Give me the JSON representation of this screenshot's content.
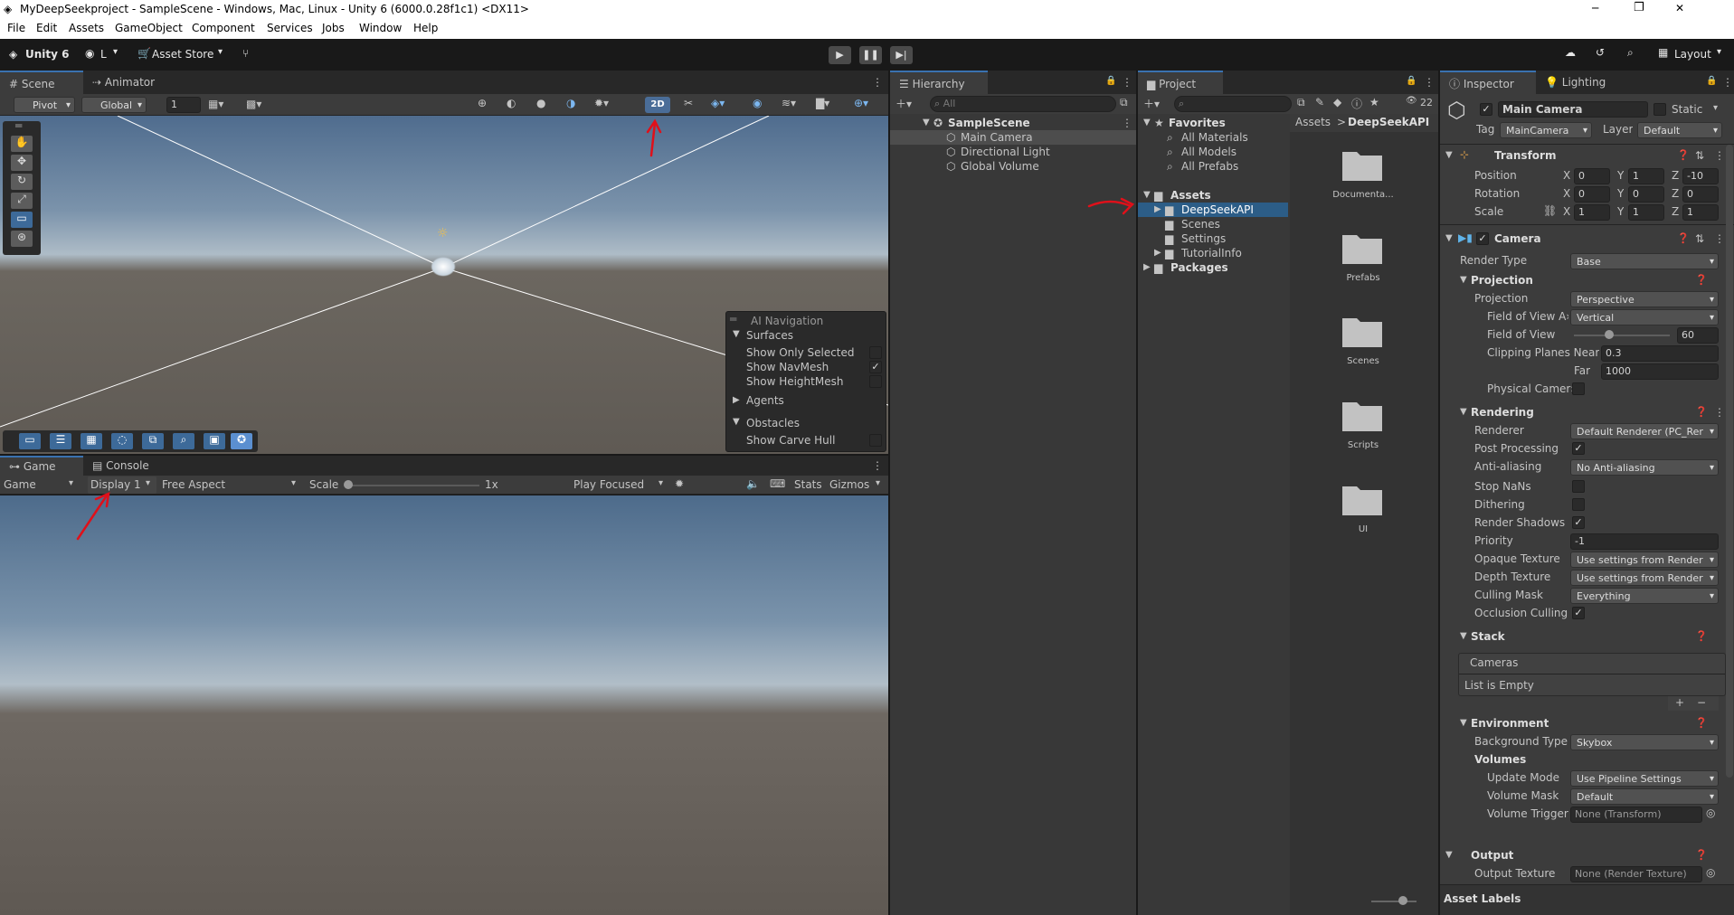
{
  "window": {
    "title": "MyDeepSeekproject - SampleScene - Windows, Mac, Linux - Unity 6 (6000.0.28f1c1) <DX11>",
    "controls": [
      "─",
      "❐",
      "✕"
    ]
  },
  "menu": [
    "File",
    "Edit",
    "Assets",
    "GameObject",
    "Component",
    "Services",
    "Jobs",
    "Window",
    "Help"
  ],
  "toolbar": {
    "unity": "Unity 6",
    "account": "L",
    "asset_store": "Asset Store",
    "layout": "Layout"
  },
  "scene": {
    "tabs": [
      "Scene",
      "Animator"
    ],
    "pivot": "Pivot",
    "global": "Global",
    "grid_value": "1",
    "mode_2d": "2D"
  },
  "ai_nav": {
    "title": "AI Navigation",
    "surfaces": "Surfaces",
    "items": [
      {
        "label": "Show Only Selected",
        "checked": false
      },
      {
        "label": "Show NavMesh",
        "checked": true
      },
      {
        "label": "Show HeightMesh",
        "checked": false
      }
    ],
    "agents": "Agents",
    "obstacles": "Obstacles",
    "carve": "Show Carve Hull"
  },
  "game": {
    "tabs": [
      "Game",
      "Console"
    ],
    "mode": "Game",
    "display": "Display 1",
    "aspect": "Free Aspect",
    "scale_label": "Scale",
    "scale_value": "1x",
    "play_focused": "Play Focused",
    "stats": "Stats",
    "gizmos": "Gizmos"
  },
  "hierarchy": {
    "tab": "Hierarchy",
    "search": "All",
    "scene": "SampleScene",
    "items": [
      "Main Camera",
      "Directional Light",
      "Global Volume"
    ]
  },
  "project": {
    "tab": "Project",
    "count": "22",
    "favorites": "Favorites",
    "fav_items": [
      "All Materials",
      "All Models",
      "All Prefabs"
    ],
    "assets": "Assets",
    "asset_items": [
      "DeepSeekAPI",
      "Scenes",
      "Settings",
      "TutorialInfo"
    ],
    "packages": "Packages",
    "breadcrumb": [
      "Assets",
      ">",
      "DeepSeekAPI"
    ],
    "folders": [
      "Documenta...",
      "Prefabs",
      "Scenes",
      "Scripts",
      "UI"
    ]
  },
  "inspector": {
    "tabs": [
      "Inspector",
      "Lighting"
    ],
    "object_name": "Main Camera",
    "static": "Static",
    "tag_label": "Tag",
    "tag": "MainCamera",
    "layer_label": "Layer",
    "layer": "Default",
    "transform": {
      "title": "Transform",
      "rows": [
        {
          "label": "Position",
          "x": "0",
          "y": "1",
          "z": "-10"
        },
        {
          "label": "Rotation",
          "x": "0",
          "y": "0",
          "z": "0"
        },
        {
          "label": "Scale",
          "x": "1",
          "y": "1",
          "z": "1"
        }
      ]
    },
    "camera": {
      "title": "Camera",
      "render_type_label": "Render Type",
      "render_type": "Base",
      "projection_header": "Projection",
      "projection_label": "Projection",
      "projection": "Perspective",
      "fov_axis_label": "Field of View A›",
      "fov_axis": "Vertical",
      "fov_label": "Field of View",
      "fov": "60",
      "fov_fraction": 0.46,
      "clip_label": "Clipping Planes Near",
      "near": "0.3",
      "far_label": "Far",
      "far": "1000",
      "physical_label": "Physical Camer›",
      "rendering_header": "Rendering",
      "renderer_label": "Renderer",
      "renderer": "Default Renderer (PC_Rer",
      "post_label": "Post Processing",
      "aa_label": "Anti-aliasing",
      "aa": "No Anti-aliasing",
      "stopnan_label": "Stop NaNs",
      "dither_label": "Dithering",
      "shadows_label": "Render Shadows",
      "priority_label": "Priority",
      "priority": "-1",
      "opaque_label": "Opaque Texture",
      "opaque": "Use settings from Render",
      "depth_label": "Depth Texture",
      "depth": "Use settings from Render",
      "culling_label": "Culling Mask",
      "culling": "Everything",
      "occlusion_label": "Occlusion Culling",
      "stack_header": "Stack",
      "cameras_label": "Cameras",
      "list_empty": "List is Empty",
      "env_header": "Environment",
      "bg_label": "Background Type",
      "bg": "Skybox",
      "volumes_label": "Volumes",
      "update_label": "Update Mode",
      "update": "Use Pipeline Settings",
      "mask_label": "Volume Mask",
      "mask": "Default",
      "trigger_label": "Volume Trigger",
      "trigger": "None (Transform)",
      "output_header": "Output",
      "output_label": "Output Texture",
      "output": "None (Render Texture)"
    },
    "asset_labels": "Asset Labels"
  }
}
